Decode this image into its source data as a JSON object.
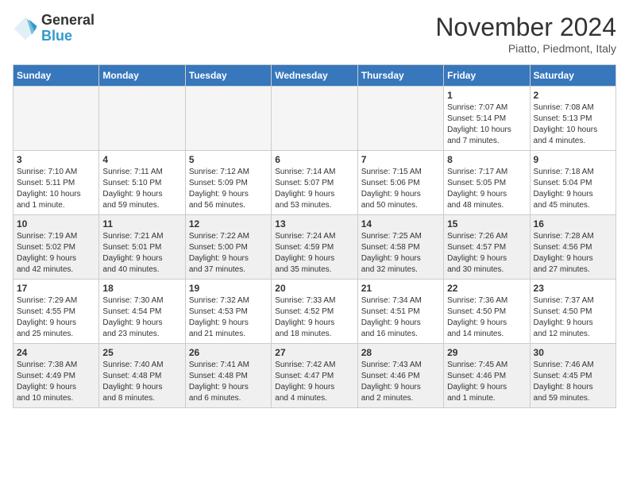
{
  "logo": {
    "general": "General",
    "blue": "Blue"
  },
  "header": {
    "month": "November 2024",
    "location": "Piatto, Piedmont, Italy"
  },
  "weekdays": [
    "Sunday",
    "Monday",
    "Tuesday",
    "Wednesday",
    "Thursday",
    "Friday",
    "Saturday"
  ],
  "weeks": [
    [
      {
        "day": "",
        "info": "",
        "empty": true
      },
      {
        "day": "",
        "info": "",
        "empty": true
      },
      {
        "day": "",
        "info": "",
        "empty": true
      },
      {
        "day": "",
        "info": "",
        "empty": true
      },
      {
        "day": "",
        "info": "",
        "empty": true
      },
      {
        "day": "1",
        "info": "Sunrise: 7:07 AM\nSunset: 5:14 PM\nDaylight: 10 hours\nand 7 minutes."
      },
      {
        "day": "2",
        "info": "Sunrise: 7:08 AM\nSunset: 5:13 PM\nDaylight: 10 hours\nand 4 minutes."
      }
    ],
    [
      {
        "day": "3",
        "info": "Sunrise: 7:10 AM\nSunset: 5:11 PM\nDaylight: 10 hours\nand 1 minute."
      },
      {
        "day": "4",
        "info": "Sunrise: 7:11 AM\nSunset: 5:10 PM\nDaylight: 9 hours\nand 59 minutes."
      },
      {
        "day": "5",
        "info": "Sunrise: 7:12 AM\nSunset: 5:09 PM\nDaylight: 9 hours\nand 56 minutes."
      },
      {
        "day": "6",
        "info": "Sunrise: 7:14 AM\nSunset: 5:07 PM\nDaylight: 9 hours\nand 53 minutes."
      },
      {
        "day": "7",
        "info": "Sunrise: 7:15 AM\nSunset: 5:06 PM\nDaylight: 9 hours\nand 50 minutes."
      },
      {
        "day": "8",
        "info": "Sunrise: 7:17 AM\nSunset: 5:05 PM\nDaylight: 9 hours\nand 48 minutes."
      },
      {
        "day": "9",
        "info": "Sunrise: 7:18 AM\nSunset: 5:04 PM\nDaylight: 9 hours\nand 45 minutes."
      }
    ],
    [
      {
        "day": "10",
        "info": "Sunrise: 7:19 AM\nSunset: 5:02 PM\nDaylight: 9 hours\nand 42 minutes."
      },
      {
        "day": "11",
        "info": "Sunrise: 7:21 AM\nSunset: 5:01 PM\nDaylight: 9 hours\nand 40 minutes."
      },
      {
        "day": "12",
        "info": "Sunrise: 7:22 AM\nSunset: 5:00 PM\nDaylight: 9 hours\nand 37 minutes."
      },
      {
        "day": "13",
        "info": "Sunrise: 7:24 AM\nSunset: 4:59 PM\nDaylight: 9 hours\nand 35 minutes."
      },
      {
        "day": "14",
        "info": "Sunrise: 7:25 AM\nSunset: 4:58 PM\nDaylight: 9 hours\nand 32 minutes."
      },
      {
        "day": "15",
        "info": "Sunrise: 7:26 AM\nSunset: 4:57 PM\nDaylight: 9 hours\nand 30 minutes."
      },
      {
        "day": "16",
        "info": "Sunrise: 7:28 AM\nSunset: 4:56 PM\nDaylight: 9 hours\nand 27 minutes."
      }
    ],
    [
      {
        "day": "17",
        "info": "Sunrise: 7:29 AM\nSunset: 4:55 PM\nDaylight: 9 hours\nand 25 minutes."
      },
      {
        "day": "18",
        "info": "Sunrise: 7:30 AM\nSunset: 4:54 PM\nDaylight: 9 hours\nand 23 minutes."
      },
      {
        "day": "19",
        "info": "Sunrise: 7:32 AM\nSunset: 4:53 PM\nDaylight: 9 hours\nand 21 minutes."
      },
      {
        "day": "20",
        "info": "Sunrise: 7:33 AM\nSunset: 4:52 PM\nDaylight: 9 hours\nand 18 minutes."
      },
      {
        "day": "21",
        "info": "Sunrise: 7:34 AM\nSunset: 4:51 PM\nDaylight: 9 hours\nand 16 minutes."
      },
      {
        "day": "22",
        "info": "Sunrise: 7:36 AM\nSunset: 4:50 PM\nDaylight: 9 hours\nand 14 minutes."
      },
      {
        "day": "23",
        "info": "Sunrise: 7:37 AM\nSunset: 4:50 PM\nDaylight: 9 hours\nand 12 minutes."
      }
    ],
    [
      {
        "day": "24",
        "info": "Sunrise: 7:38 AM\nSunset: 4:49 PM\nDaylight: 9 hours\nand 10 minutes."
      },
      {
        "day": "25",
        "info": "Sunrise: 7:40 AM\nSunset: 4:48 PM\nDaylight: 9 hours\nand 8 minutes."
      },
      {
        "day": "26",
        "info": "Sunrise: 7:41 AM\nSunset: 4:48 PM\nDaylight: 9 hours\nand 6 minutes."
      },
      {
        "day": "27",
        "info": "Sunrise: 7:42 AM\nSunset: 4:47 PM\nDaylight: 9 hours\nand 4 minutes."
      },
      {
        "day": "28",
        "info": "Sunrise: 7:43 AM\nSunset: 4:46 PM\nDaylight: 9 hours\nand 2 minutes."
      },
      {
        "day": "29",
        "info": "Sunrise: 7:45 AM\nSunset: 4:46 PM\nDaylight: 9 hours\nand 1 minute."
      },
      {
        "day": "30",
        "info": "Sunrise: 7:46 AM\nSunset: 4:45 PM\nDaylight: 8 hours\nand 59 minutes."
      }
    ]
  ]
}
